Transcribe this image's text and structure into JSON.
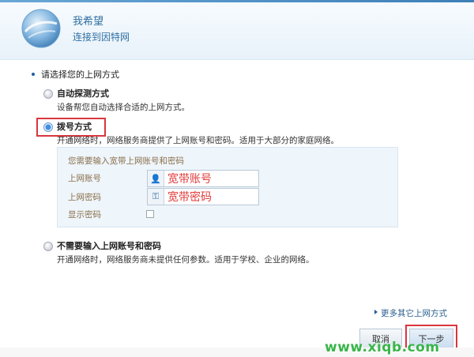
{
  "header": {
    "title": "我希望",
    "subtitle": "连接到因特网"
  },
  "prompt": "请选择您的上网方式",
  "options": [
    {
      "label": "自动探测方式",
      "desc": "设备帮您自动选择合适的上网方式。",
      "selected": false
    },
    {
      "label": "拨号方式",
      "desc": "开通网络时，网络服务商提供了上网账号和密码。适用于大部分的家庭网络。",
      "selected": true
    },
    {
      "label": "不需要输入上网账号和密码",
      "desc": "开通网络时，网络服务商未提供任何参数。适用于学校、企业的网络。",
      "selected": false
    }
  ],
  "panel": {
    "title": "您需要输入宽带上网账号和密码",
    "account_label": "上网账号",
    "account_value": "宽带账号",
    "password_label": "上网密码",
    "password_value": "宽带密码",
    "show_password_label": "显示密码"
  },
  "more_link": "更多其它上网方式",
  "buttons": {
    "cancel": "取消",
    "next": "下一步"
  },
  "watermark": "www.xiqb.com",
  "colors": {
    "accent": "#2f6fa3",
    "highlight": "#d9363e",
    "field_text": "#e33b3b",
    "watermark": "#39b54a"
  }
}
